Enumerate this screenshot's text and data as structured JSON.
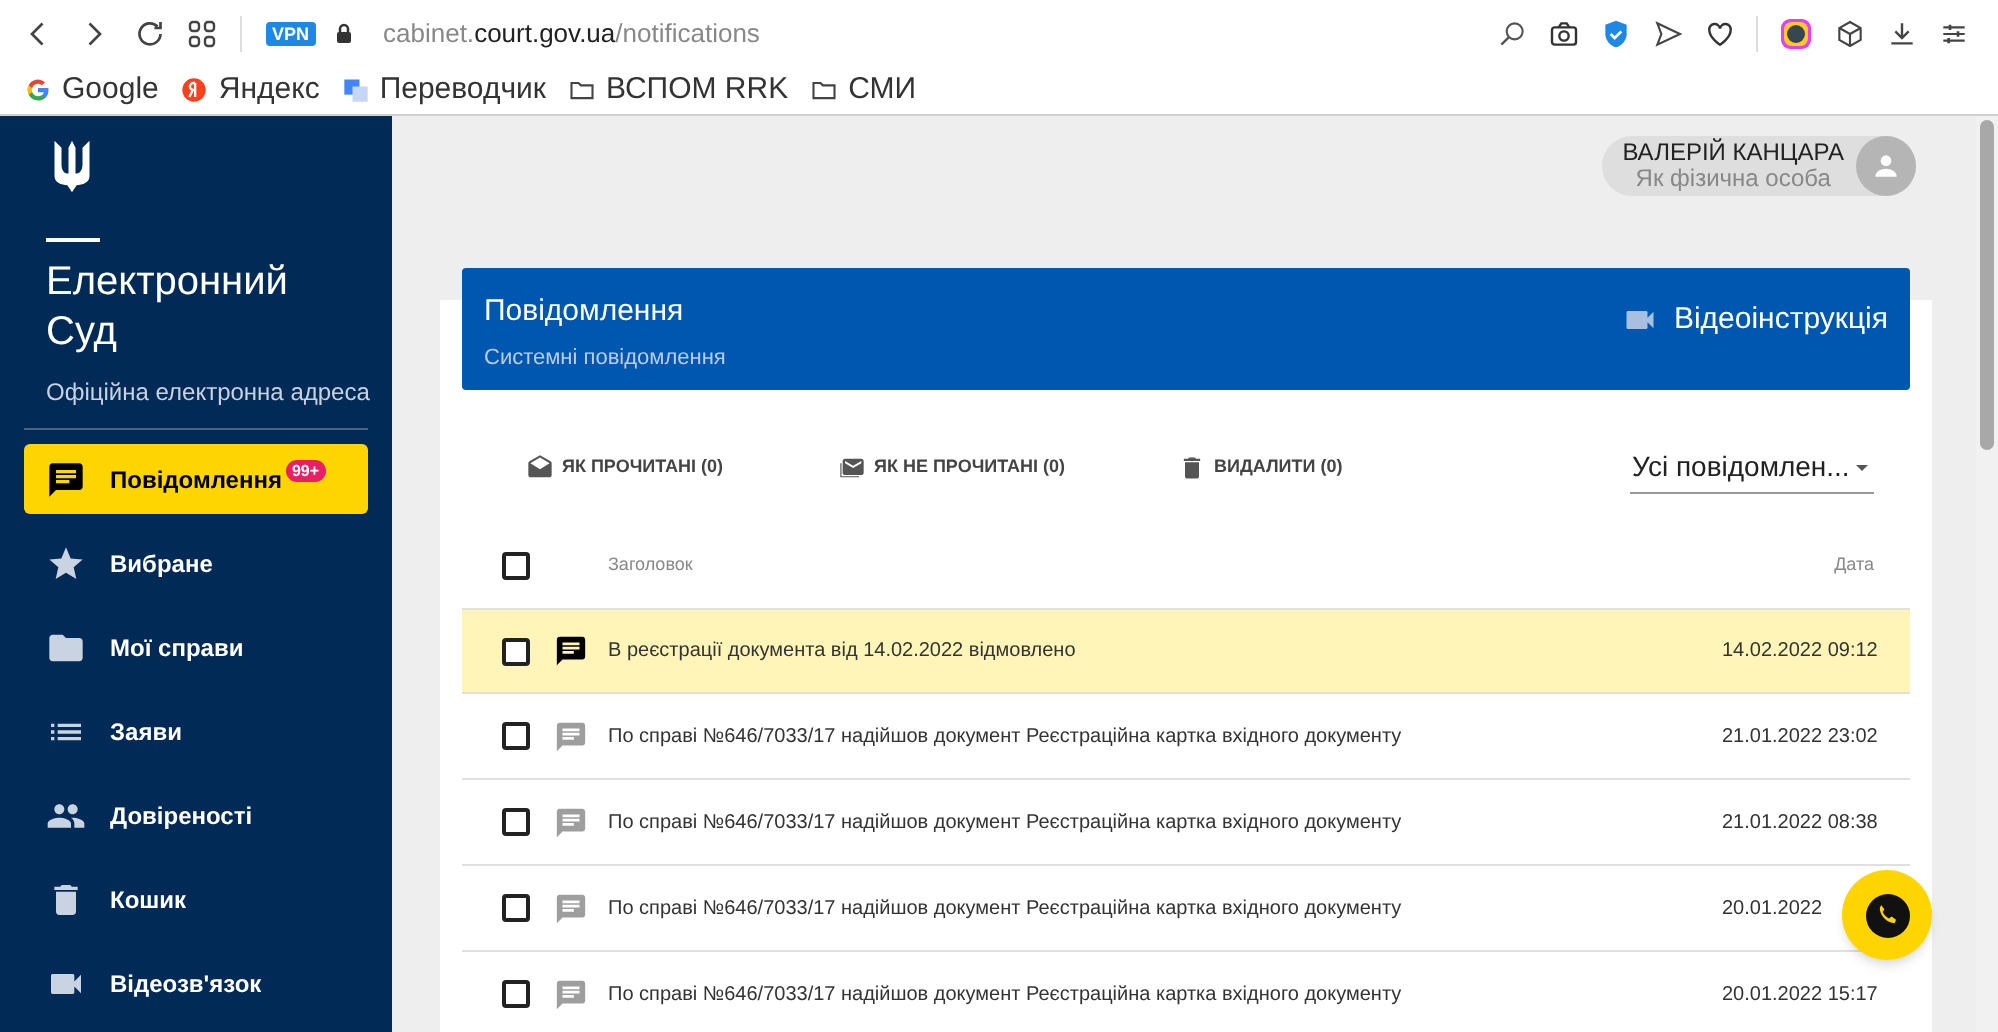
{
  "browser": {
    "vpn_badge": "VPN",
    "url_parts": [
      {
        "text": "cabinet.",
        "strong": false
      },
      {
        "text": "court.gov.ua",
        "strong": true
      },
      {
        "text": "/notifications",
        "strong": false
      }
    ],
    "bookmarks": [
      {
        "kind": "google",
        "label": "Google"
      },
      {
        "kind": "yandex",
        "label": "Яндекс"
      },
      {
        "kind": "translate",
        "label": "Переводчик"
      },
      {
        "kind": "folder",
        "label": "ВСПОМ RRK"
      },
      {
        "kind": "folder",
        "label": "СМИ"
      }
    ]
  },
  "sidebar": {
    "title_lines": [
      "Електронний",
      "Суд"
    ],
    "subtitle": "Офіційна електронна адреса",
    "items": [
      {
        "kind": "message",
        "label": "Повідомлення",
        "badge": "99+",
        "selected": true
      },
      {
        "kind": "star",
        "label": "Вибране",
        "selected": false
      },
      {
        "kind": "folder",
        "label": "Мої справи",
        "selected": false
      },
      {
        "kind": "list",
        "label": "Заяви",
        "selected": false
      },
      {
        "kind": "people",
        "label": "Довіреності",
        "selected": false
      },
      {
        "kind": "trash",
        "label": "Кошик",
        "selected": false
      },
      {
        "kind": "video",
        "label": "Відеозв'язок",
        "selected": false
      }
    ]
  },
  "user": {
    "name": "ВАЛЕРІЙ КАНЦАРА",
    "role": "Як фізична особа"
  },
  "panel": {
    "title": "Повідомлення",
    "subtitle": "Системні повідомлення",
    "video_link": "Відеоінструкція"
  },
  "actions": [
    {
      "kind": "open-mail",
      "label": "ЯК ПРОЧИТАНІ (0)"
    },
    {
      "kind": "closed-mail",
      "label": "ЯК НЕ ПРОЧИТАНІ (0)"
    },
    {
      "kind": "trash",
      "label": "ВИДАЛИТИ (0)"
    }
  ],
  "filter": {
    "value": "Усі повідомлен..."
  },
  "table": {
    "columns": [
      "Заголовок",
      "Дата"
    ],
    "select_all_checked": false,
    "rows": [
      {
        "title": "В реєстрації документа від 14.02.2022 відмовлено",
        "date": "14.02.2022 09:12",
        "unread": true,
        "checked": false
      },
      {
        "title": "По справі №646/7033/17 надійшов документ Реєстраційна картка вхідного документу",
        "date": "21.01.2022 23:02",
        "unread": false,
        "checked": false
      },
      {
        "title": "По справі №646/7033/17 надійшов документ Реєстраційна картка вхідного документу",
        "date": "21.01.2022 08:38",
        "unread": false,
        "checked": false
      },
      {
        "title": "По справі №646/7033/17 надійшов документ Реєстраційна картка вхідного документу",
        "date": "20.01.2022",
        "unread": false,
        "checked": false
      },
      {
        "title": "По справі №646/7033/17 надійшов документ Реєстраційна картка вхідного документу",
        "date": "20.01.2022 15:17",
        "unread": false,
        "checked": false
      }
    ]
  }
}
